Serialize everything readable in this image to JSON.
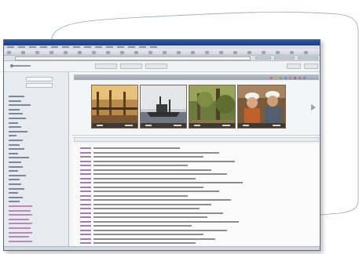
{
  "browser": {
    "menu_count": 14,
    "toolbar_button_count": 22
  },
  "app": {
    "logo_text": "",
    "nav": [
      "",
      "",
      ""
    ],
    "side_fields": [
      "",
      ""
    ]
  },
  "colors": {
    "title_bar": "#2b55a8",
    "sidebar": "#e7eaee",
    "result_number": "#a27ab8",
    "deco_line": "#9aa6b3",
    "status_dots": [
      "#e06060",
      "#e6a040",
      "#66b366",
      "#5a8ad6",
      "#c070c0",
      "#7a7a7a"
    ]
  },
  "icons": {
    "browser_buttons": "toolbar-button-icon",
    "status_dots": "status-dot-icon"
  },
  "thumbnails": [
    {
      "name": "industrial-interior"
    },
    {
      "name": "ship-on-water"
    },
    {
      "name": "forest-scene"
    },
    {
      "name": "workers-in-hard-hats"
    }
  ],
  "results": {
    "row_count": 24
  }
}
